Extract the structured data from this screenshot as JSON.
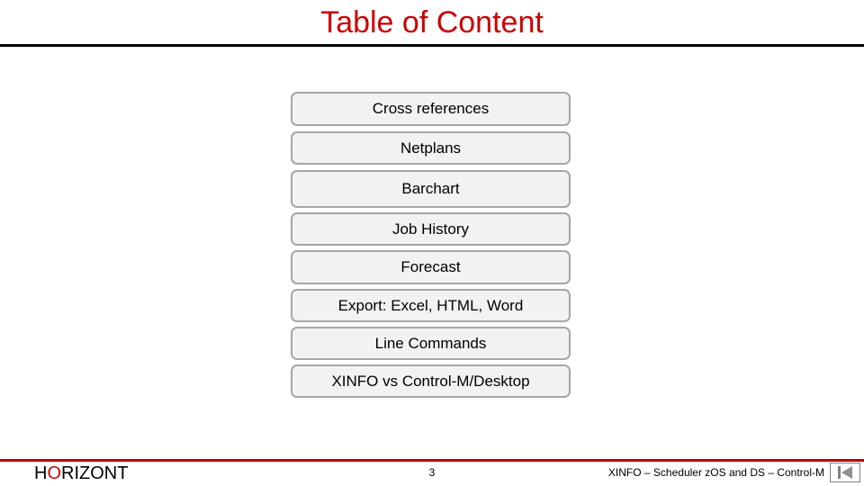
{
  "header": {
    "title": "Table of Content"
  },
  "toc": {
    "items": [
      {
        "label": "Cross references"
      },
      {
        "label": "Netplans"
      },
      {
        "label": "Barchart"
      },
      {
        "label": "Job History"
      },
      {
        "label": "Forecast"
      },
      {
        "label": "Export: Excel, HTML, Word"
      },
      {
        "label": "Line Commands"
      },
      {
        "label": "XINFO vs Control-M/Desktop"
      }
    ]
  },
  "footer": {
    "logo_pre": "H",
    "logo_o": "O",
    "logo_post": "RIZONT",
    "page_number": "3",
    "text": "XINFO – Scheduler zOS and DS – Control-M",
    "nav_icon": "first-slide-icon"
  },
  "colors": {
    "title": "#cc0000",
    "accent": "#c00000",
    "button_bg": "#f2f2f2",
    "button_border": "#a6a6a6"
  }
}
